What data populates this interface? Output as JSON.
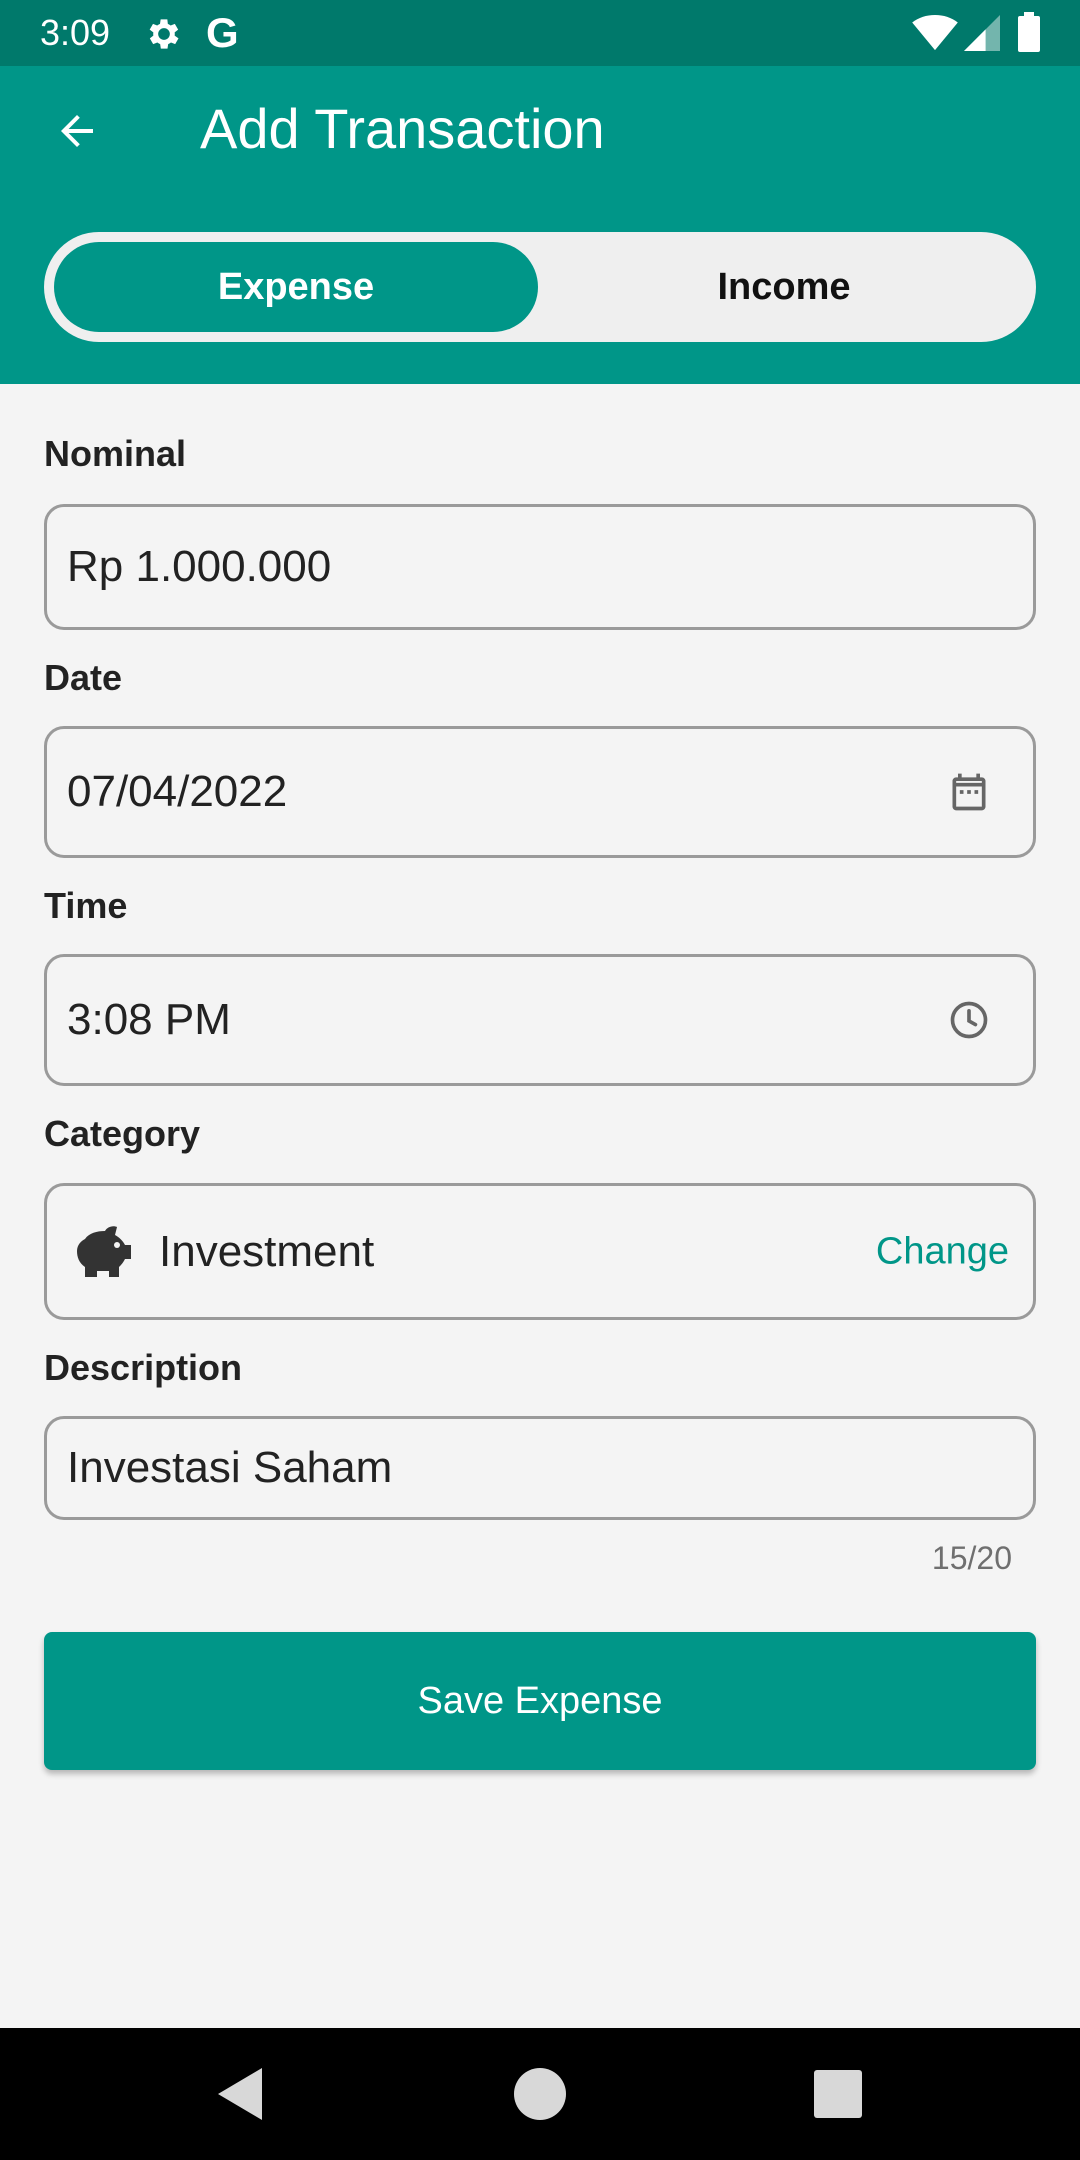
{
  "status_bar": {
    "time": "3:09",
    "g_label": "G",
    "icons": [
      "gear-icon",
      "google-icon",
      "wifi-icon",
      "signal-icon",
      "battery-icon"
    ]
  },
  "header": {
    "title": "Add Transaction",
    "back_icon": "arrow-left-icon",
    "background_color": "#009688"
  },
  "type_toggle": {
    "options": [
      "Expense",
      "Income"
    ],
    "selected": "Expense"
  },
  "form": {
    "nominal": {
      "label": "Nominal",
      "value": "Rp 1.000.000"
    },
    "date": {
      "label": "Date",
      "value": "07/04/2022",
      "icon": "calendar-icon"
    },
    "time": {
      "label": "Time",
      "value": "3:08 PM",
      "icon": "clock-icon"
    },
    "category": {
      "label": "Category",
      "value": "Investment",
      "icon": "piggy-bank-icon",
      "action": "Change"
    },
    "description": {
      "label": "Description",
      "value": "Investasi Saham",
      "counter": "15/20"
    }
  },
  "save_button": {
    "label": "Save Expense"
  },
  "colors": {
    "accent": "#009688",
    "status_bar": "#00796b",
    "background": "#f4f4f4"
  },
  "nav_bar": {
    "icons": [
      "back-triangle-icon",
      "home-circle-icon",
      "recents-square-icon"
    ]
  }
}
